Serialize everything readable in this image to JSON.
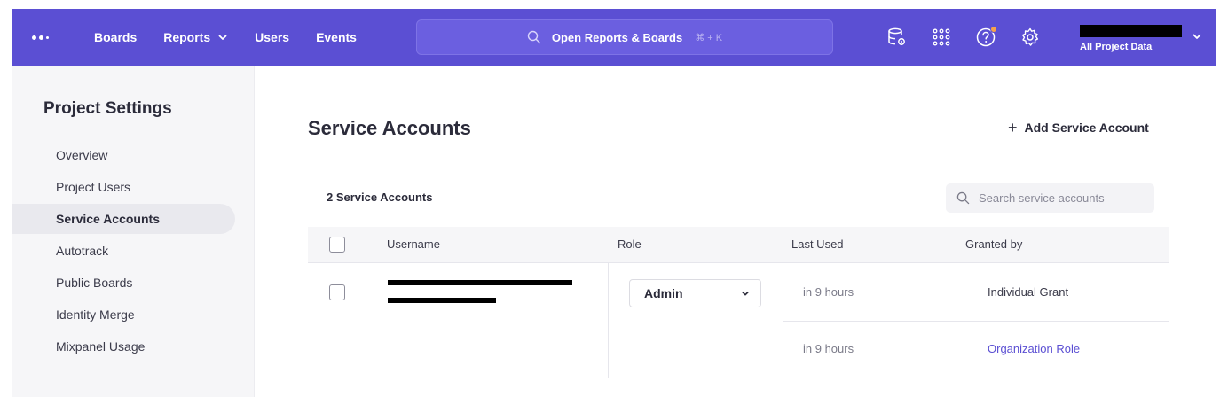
{
  "nav": {
    "logo": "logo",
    "items": [
      {
        "label": "Boards"
      },
      {
        "label": "Reports",
        "has_menu": true
      },
      {
        "label": "Users"
      },
      {
        "label": "Events"
      }
    ],
    "search": {
      "label": "Open Reports & Boards",
      "shortcut": "⌘ + K"
    },
    "icons": [
      "data-management-icon",
      "apps-grid-icon",
      "help-icon",
      "settings-gear-icon"
    ],
    "project_label": "All Project Data",
    "accent_color": "#5b4fd3",
    "notification_color": "#f7a24a"
  },
  "sidebar": {
    "title": "Project Settings",
    "items": [
      {
        "label": "Overview"
      },
      {
        "label": "Project Users"
      },
      {
        "label": "Service Accounts",
        "active": true
      },
      {
        "label": "Autotrack"
      },
      {
        "label": "Public Boards"
      },
      {
        "label": "Identity Merge"
      },
      {
        "label": "Mixpanel Usage"
      }
    ]
  },
  "main": {
    "title": "Service Accounts",
    "add_label": "Add Service Account",
    "count_label": "2 Service Accounts",
    "search_placeholder": "Search service accounts",
    "columns": [
      "Username",
      "Role",
      "Last Used",
      "Granted by"
    ],
    "rows": [
      {
        "role": "Admin",
        "grants": [
          {
            "last_used": "in 9 hours",
            "granted_by": "Individual Grant",
            "is_link": false
          },
          {
            "last_used": "in 9 hours",
            "granted_by": "Organization Role",
            "is_link": true
          }
        ]
      }
    ]
  }
}
